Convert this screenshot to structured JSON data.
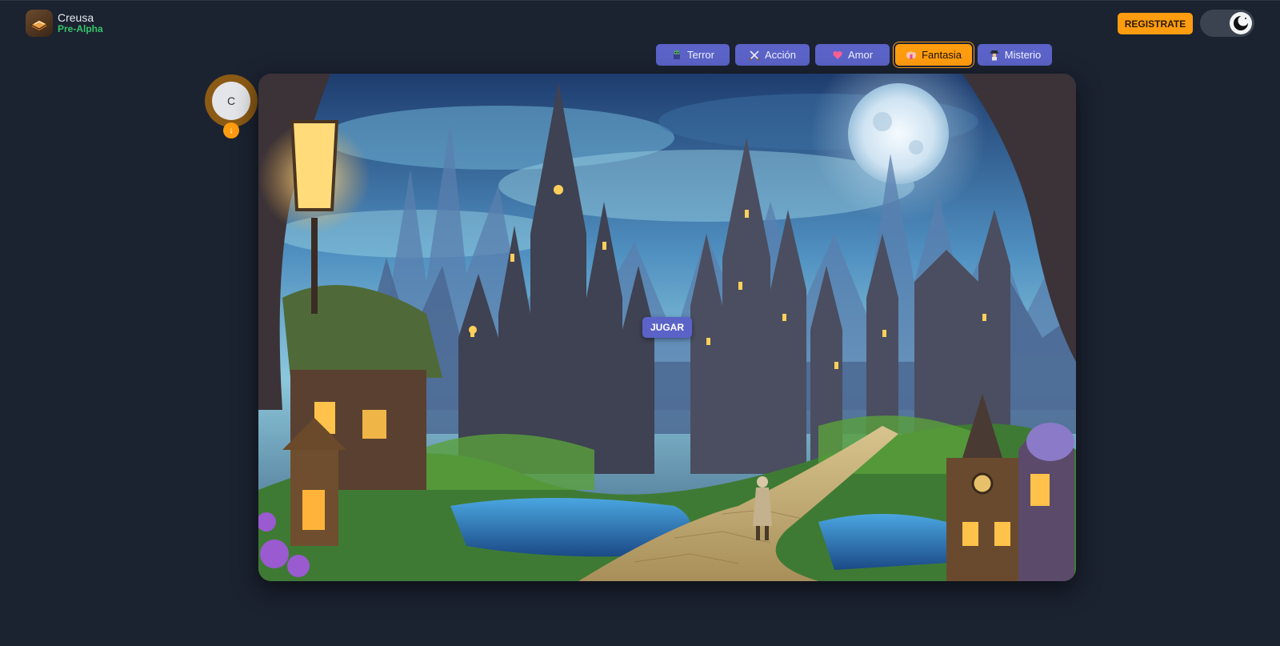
{
  "brand": {
    "name": "Creusa",
    "tag": "Pre-Alpha",
    "logo_icon": "book-icon"
  },
  "header": {
    "register_label": "REGISTRATE",
    "theme_toggle_icon": "moon-icon"
  },
  "genres": [
    {
      "label": "Terror",
      "icon": "zombie-icon",
      "active": false
    },
    {
      "label": "Acción",
      "icon": "crossed-swords-icon",
      "active": false
    },
    {
      "label": "Amor",
      "icon": "heart-icon",
      "active": false
    },
    {
      "label": "Fantasia",
      "icon": "fairy-icon",
      "active": true
    },
    {
      "label": "Misterio",
      "icon": "detective-icon",
      "active": false
    }
  ],
  "avatar": {
    "initial": "C",
    "badge": "↓"
  },
  "scene": {
    "image_subject": "fantasy castle town illustration",
    "play_label": "JUGAR"
  },
  "colors": {
    "background": "#1b2230",
    "accent_orange": "#ff9c10",
    "accent_indigo": "#5b63c8",
    "brand_tag_green": "#35c46a"
  }
}
